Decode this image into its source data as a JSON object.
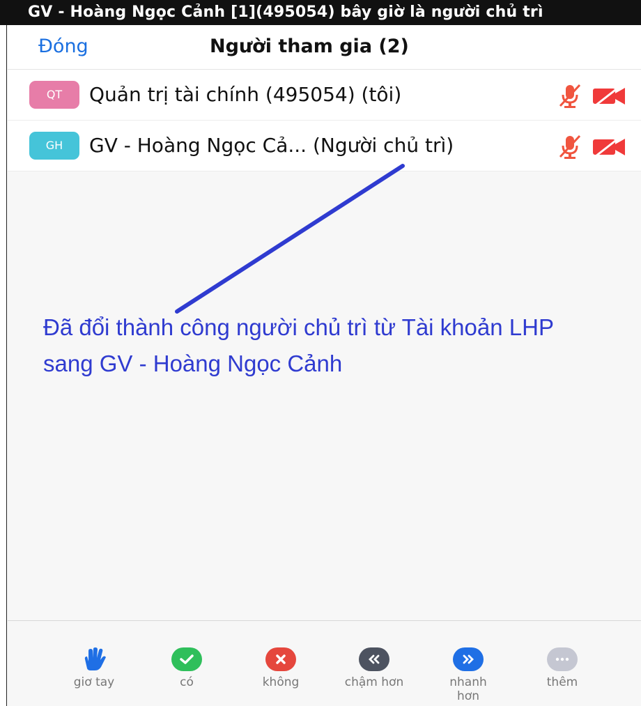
{
  "banner": {
    "text": "GV - Hoàng Ngọc Cảnh [1](495054) bây giờ là người chủ trì"
  },
  "header": {
    "close_label": "Đóng",
    "title": "Người tham gia (2)"
  },
  "participants": [
    {
      "initials": "QT",
      "name": "Quản trị tài chính (495054) (tôi)",
      "avatar_color": "#e77da8",
      "mic": "muted",
      "video": "off"
    },
    {
      "initials": "GH",
      "name": "GV - Hoàng Ngọc Cả...  (Người chủ trì)",
      "avatar_color": "#45c4d9",
      "mic": "muted",
      "video": "off"
    }
  ],
  "annotation": {
    "line1": "Đã đổi thành công người chủ trì từ Tài khoản LHP",
    "line2": "sang GV - Hoàng Ngọc Cảnh",
    "color": "#2f3bd0"
  },
  "toolbar": {
    "items": [
      {
        "label": "giơ tay",
        "icon": "raise-hand-icon",
        "color": "#1f6fe5"
      },
      {
        "label": "có",
        "icon": "check-icon",
        "color": "#2fbf5b"
      },
      {
        "label": "không",
        "icon": "x-icon",
        "color": "#e5473d"
      },
      {
        "label": "chậm hơn",
        "icon": "rewind-icon",
        "color": "#4d5360"
      },
      {
        "label": "nhanh hơn",
        "icon": "fast-forward-icon",
        "color": "#1f6fe5"
      },
      {
        "label": "thêm",
        "icon": "more-icon",
        "color": "#c5c7d2"
      }
    ]
  }
}
